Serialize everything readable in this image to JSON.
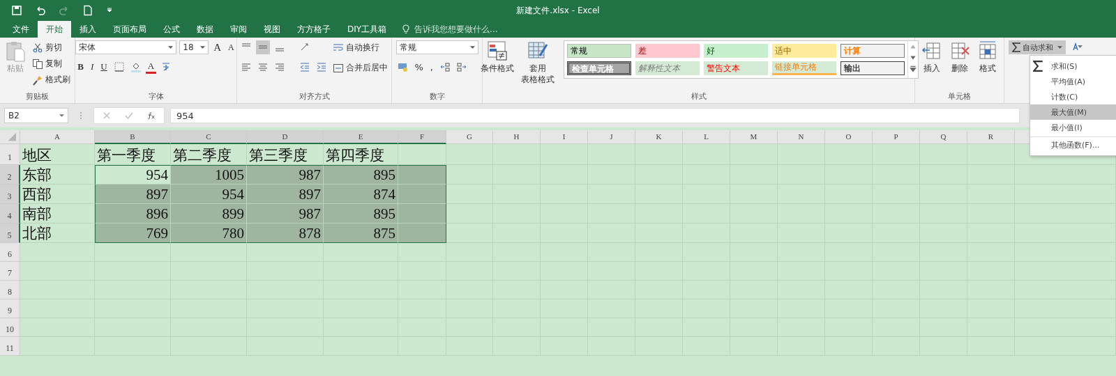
{
  "window": {
    "title": "新建文件.xlsx - Excel"
  },
  "tabs": [
    {
      "label": "文件",
      "selected": false
    },
    {
      "label": "开始",
      "selected": true
    },
    {
      "label": "插入",
      "selected": false
    },
    {
      "label": "页面布局",
      "selected": false
    },
    {
      "label": "公式",
      "selected": false
    },
    {
      "label": "数据",
      "selected": false
    },
    {
      "label": "审阅",
      "selected": false
    },
    {
      "label": "视图",
      "selected": false
    },
    {
      "label": "方方格子",
      "selected": false
    },
    {
      "label": "DIY工具箱",
      "selected": false
    }
  ],
  "tell_me": {
    "placeholder": "告诉我您想要做什么..."
  },
  "ribbon": {
    "clipboard": {
      "label": "剪贴板",
      "paste": "粘贴",
      "cut": "剪切",
      "copy": "复制",
      "format_painter": "格式刷"
    },
    "font": {
      "label": "字体",
      "family": "宋体",
      "size": "18",
      "grow": "A",
      "shrink": "A",
      "bold": "B",
      "italic": "I",
      "underline": "U",
      "font_color": "A"
    },
    "alignment": {
      "label": "对齐方式",
      "wrap": "自动换行",
      "merge": "合并后居中"
    },
    "number": {
      "label": "数字",
      "format": "常规",
      "percent": "%",
      "comma": ","
    },
    "conditional": "条件格式",
    "table_format_1": "套用",
    "table_format_2": "表格格式",
    "styles": {
      "label": "样式",
      "items": [
        {
          "text": "常规",
          "kind": "normal"
        },
        {
          "text": "差",
          "kind": "bad"
        },
        {
          "text": "好",
          "kind": "good"
        },
        {
          "text": "适中",
          "kind": "neutral"
        },
        {
          "text": "计算",
          "kind": "calculation"
        },
        {
          "text": "检查单元格",
          "kind": "check"
        },
        {
          "text": "解释性文本",
          "kind": "explanatory"
        },
        {
          "text": "警告文本",
          "kind": "warning"
        },
        {
          "text": "链接单元格",
          "kind": "linked"
        },
        {
          "text": "输出",
          "kind": "output"
        }
      ]
    },
    "cells": {
      "label": "单元格",
      "insert": "插入",
      "delete": "删除",
      "format": "格式"
    },
    "autosum": "自动求和"
  },
  "autosum_menu": [
    {
      "text": "求和(S)",
      "kind": "sum",
      "selected": false
    },
    {
      "text": "平均值(A)",
      "kind": "plain",
      "selected": false
    },
    {
      "text": "计数(C)",
      "kind": "plain",
      "selected": false
    },
    {
      "text": "最大值(M)",
      "kind": "plain",
      "selected": true
    },
    {
      "text": "最小值(I)",
      "kind": "plain",
      "selected": false
    },
    {
      "text": "其他函数(F)...",
      "kind": "more",
      "selected": false
    }
  ],
  "formula_bar": {
    "name_box": "B2",
    "formula": "954"
  },
  "sheet": {
    "columns": [
      {
        "label": "A",
        "selected": false
      },
      {
        "label": "B",
        "selected": true
      },
      {
        "label": "C",
        "selected": true
      },
      {
        "label": "D",
        "selected": true
      },
      {
        "label": "E",
        "selected": true
      },
      {
        "label": "F",
        "selected": true
      },
      {
        "label": "G",
        "selected": false
      },
      {
        "label": "H",
        "selected": false
      },
      {
        "label": "I",
        "selected": false
      },
      {
        "label": "J",
        "selected": false
      },
      {
        "label": "K",
        "selected": false
      },
      {
        "label": "L",
        "selected": false
      },
      {
        "label": "M",
        "selected": false
      },
      {
        "label": "N",
        "selected": false
      },
      {
        "label": "O",
        "selected": false
      },
      {
        "label": "P",
        "selected": false
      },
      {
        "label": "Q",
        "selected": false
      },
      {
        "label": "R",
        "selected": false
      }
    ],
    "rows": [
      {
        "label": "1",
        "selected": false,
        "cells": [
          {
            "text": "地区",
            "kind": "text"
          },
          {
            "text": "第一季度",
            "kind": "text"
          },
          {
            "text": "第二季度",
            "kind": "text"
          },
          {
            "text": "第三季度",
            "kind": "text"
          },
          {
            "text": "第四季度",
            "kind": "text"
          }
        ]
      },
      {
        "label": "2",
        "selected": true,
        "cells": [
          {
            "text": "东部",
            "kind": "text"
          },
          {
            "text": "954",
            "kind": "number"
          },
          {
            "text": "1005",
            "kind": "number"
          },
          {
            "text": "987",
            "kind": "number"
          },
          {
            "text": "895",
            "kind": "number"
          }
        ]
      },
      {
        "label": "3",
        "selected": true,
        "cells": [
          {
            "text": "西部",
            "kind": "text"
          },
          {
            "text": "897",
            "kind": "number"
          },
          {
            "text": "954",
            "kind": "number"
          },
          {
            "text": "897",
            "kind": "number"
          },
          {
            "text": "874",
            "kind": "number"
          }
        ]
      },
      {
        "label": "4",
        "selected": true,
        "cells": [
          {
            "text": "南部",
            "kind": "text"
          },
          {
            "text": "896",
            "kind": "number"
          },
          {
            "text": "899",
            "kind": "number"
          },
          {
            "text": "987",
            "kind": "number"
          },
          {
            "text": "895",
            "kind": "number"
          }
        ]
      },
      {
        "label": "5",
        "selected": true,
        "cells": [
          {
            "text": "北部",
            "kind": "text"
          },
          {
            "text": "769",
            "kind": "number"
          },
          {
            "text": "780",
            "kind": "number"
          },
          {
            "text": "878",
            "kind": "number"
          },
          {
            "text": "875",
            "kind": "number"
          }
        ]
      },
      {
        "label": "6",
        "selected": false,
        "cells": []
      },
      {
        "label": "7",
        "selected": false,
        "cells": []
      },
      {
        "label": "8",
        "selected": false,
        "cells": []
      },
      {
        "label": "9",
        "selected": false,
        "cells": []
      },
      {
        "label": "10",
        "selected": false,
        "cells": []
      },
      {
        "label": "11",
        "selected": false,
        "cells": []
      }
    ]
  }
}
